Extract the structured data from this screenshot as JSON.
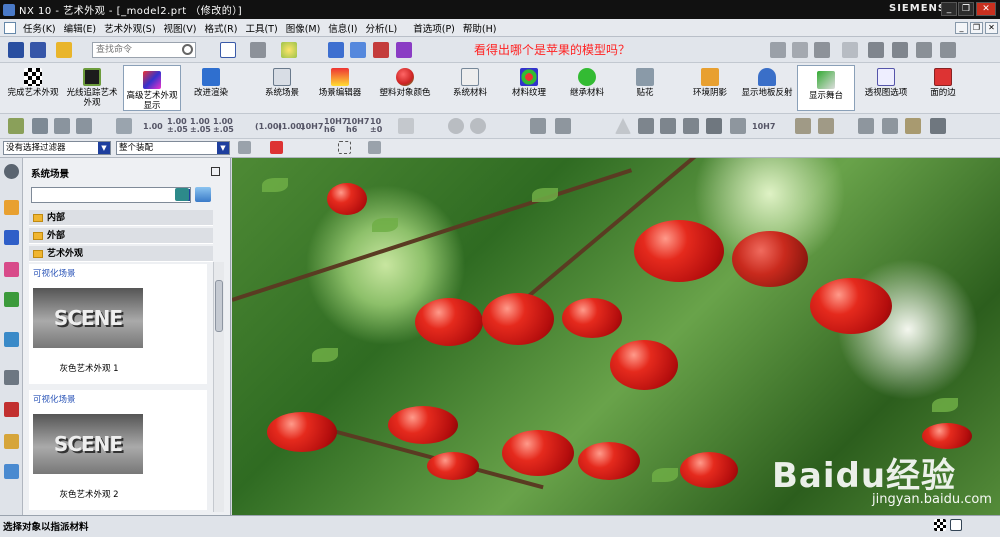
{
  "window": {
    "title": "NX 10 - 艺术外观 - [_model2.prt （修改的）]",
    "brand": "SIEMENS",
    "controls": [
      "_",
      "❐",
      "✕"
    ],
    "mdi_controls": [
      "_",
      "❐",
      "✕"
    ]
  },
  "menu": [
    "任务(K)",
    "编辑(E)",
    "艺术外观(S)",
    "视图(V)",
    "格式(R)",
    "工具(T)",
    "图像(M)",
    "信息(I)",
    "分析(L)",
    "首选项(P)",
    "帮助(H)"
  ],
  "search": {
    "placeholder": "查找命令"
  },
  "question_banner": "看得出哪个是苹果的模型吗？",
  "ribbon": [
    {
      "label": "完成艺术外观"
    },
    {
      "label": "光线追踪艺术\n外观"
    },
    {
      "label": "高级艺术外观\n显示"
    },
    {
      "label": "改进渲染"
    },
    {
      "label": "系统场景"
    },
    {
      "label": "场景编辑器"
    },
    {
      "label": "塑料对象颜色"
    },
    {
      "label": "系统材料"
    },
    {
      "label": "材料纹理"
    },
    {
      "label": "继承材料"
    },
    {
      "label": "贴花"
    },
    {
      "label": "环境阴影"
    },
    {
      "label": "显示地板反射"
    },
    {
      "label": "显示舞台"
    },
    {
      "label": "透视图选项"
    },
    {
      "label": "面的边"
    }
  ],
  "format_toolbar_labels": [
    "1.00",
    "1.00\n±.05",
    "1.00\n±.05",
    "1.00\n±.05",
    "(1.00)",
    "(1.00)",
    "10H7",
    "10H7\nh6",
    "10H7\nh6",
    "10\n±0",
    "10H7"
  ],
  "filters": {
    "selection_filter": "没有选择过滤器",
    "scope": "整个装配"
  },
  "panel": {
    "title": "系统场景",
    "folders": [
      "内部",
      "外部",
      "艺术外观"
    ],
    "scenes": [
      {
        "header": "可视化场景",
        "thumb_text": "SCENE",
        "caption": "灰色艺术外观 1"
      },
      {
        "header": "可视化场景",
        "thumb_text": "SCENE",
        "caption": "灰色艺术外观 2"
      }
    ]
  },
  "watermark": {
    "brand": "Baidu经验",
    "url": "jingyan.baidu.com"
  },
  "status": "选择对象以指派材料",
  "colors": {
    "titlebar": "#111111",
    "question": "#ff2222",
    "combo_arrow": "#1e3f9e",
    "link_header": "#2c56b8"
  }
}
